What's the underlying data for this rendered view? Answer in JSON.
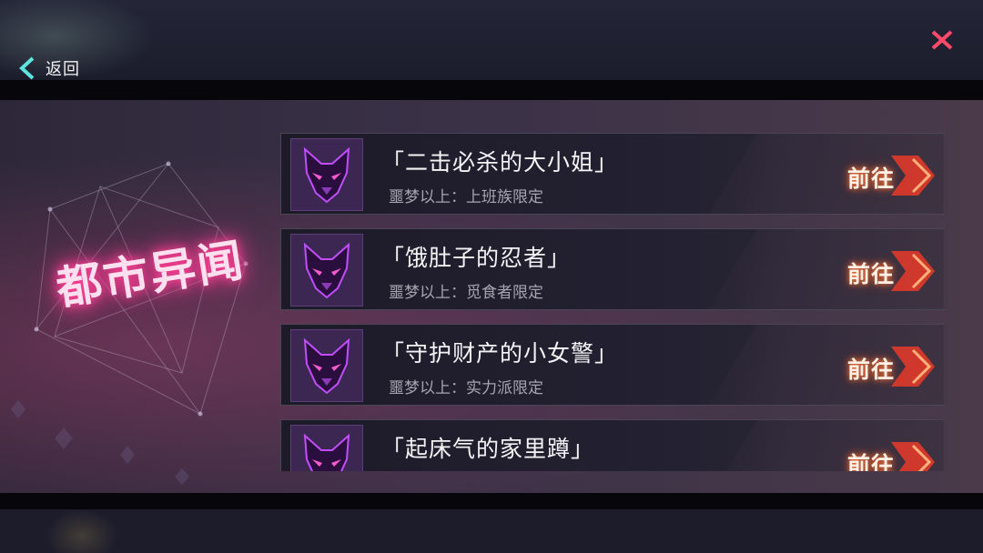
{
  "header": {
    "back_label": "返回",
    "back_icon": "chevron-left-icon",
    "close_icon": "close-icon"
  },
  "event": {
    "title": "都市异闻"
  },
  "entries": [
    {
      "title": "「二击必杀的大小姐」",
      "subtitle": "噩梦以上：上班族限定",
      "go_label": "前往",
      "icon": "wolf-icon"
    },
    {
      "title": "「饿肚子的忍者」",
      "subtitle": "噩梦以上：觅食者限定",
      "go_label": "前往",
      "icon": "wolf-icon"
    },
    {
      "title": "「守护财产的小女警」",
      "subtitle": "噩梦以上：实力派限定",
      "go_label": "前往",
      "icon": "wolf-icon"
    },
    {
      "title": "「起床气的家里蹲」",
      "subtitle": "",
      "go_label": "前往",
      "icon": "wolf-icon"
    }
  ],
  "colors": {
    "accent_cyan": "#5fe3e0",
    "close_red": "#ff4a6a",
    "neon_pink": "#ff3f95",
    "go_orange": "#e03a2a"
  }
}
